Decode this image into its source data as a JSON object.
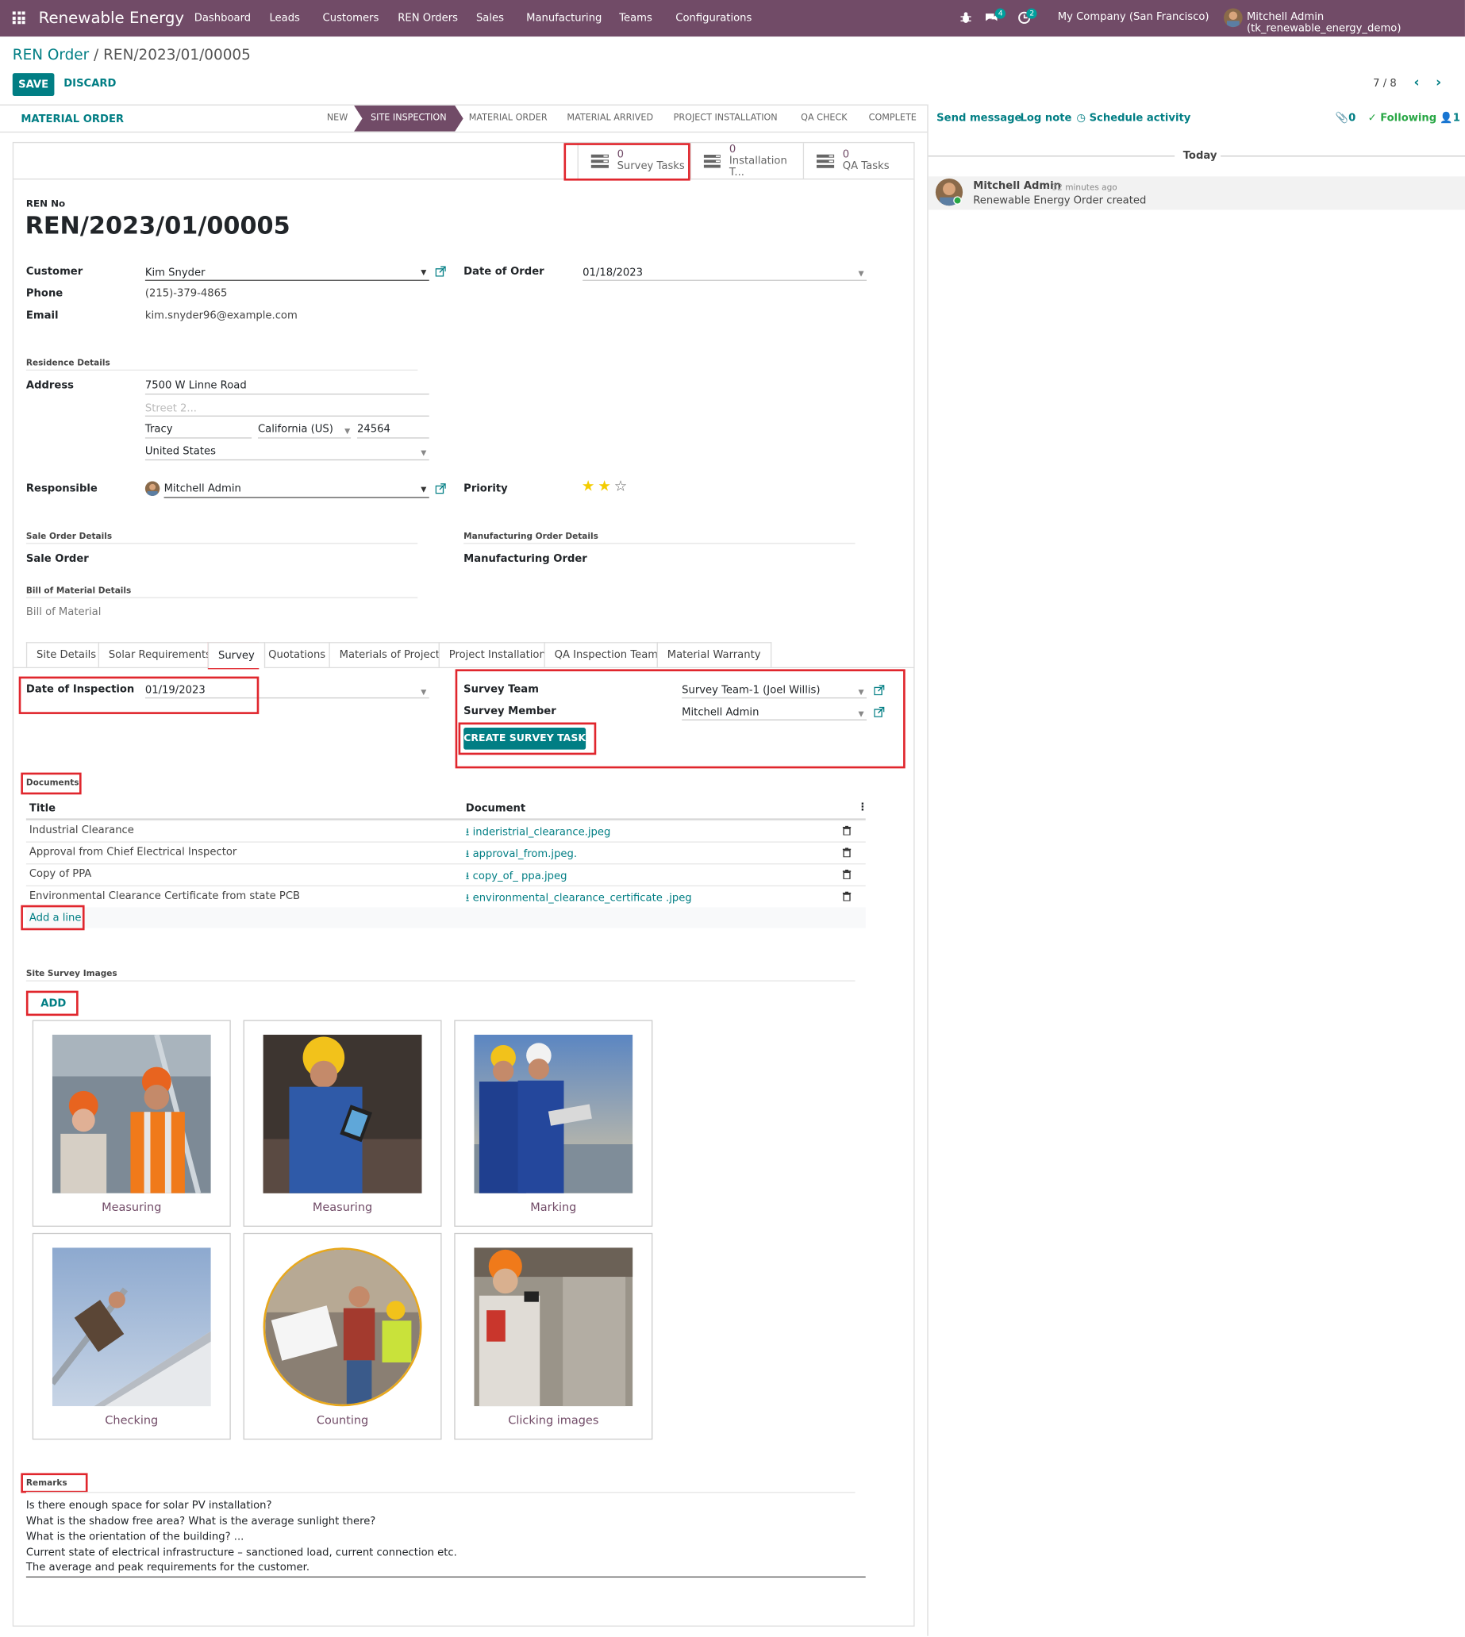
{
  "navbar": {
    "brand": "Renewable Energy",
    "menu": [
      "Dashboard",
      "Leads",
      "Customers",
      "REN Orders",
      "Sales",
      "Manufacturing",
      "Teams",
      "Configurations"
    ],
    "messages_badge": "4",
    "activities_badge": "2",
    "company": "My Company (San Francisco)",
    "user": "Mitchell Admin (tk_renewable_energy_demo)"
  },
  "breadcrumb": {
    "parent": "REN Order",
    "separator": " / ",
    "current": "REN/2023/01/00005"
  },
  "controls": {
    "save": "SAVE",
    "discard": "DISCARD",
    "pager": "7 / 8"
  },
  "statusbar": {
    "button": "MATERIAL ORDER",
    "stages": [
      "NEW",
      "SITE INSPECTION",
      "MATERIAL ORDER",
      "MATERIAL ARRIVED",
      "PROJECT INSTALLATION",
      "QA CHECK",
      "COMPLETE"
    ],
    "active_stage": "SITE INSPECTION"
  },
  "smart_buttons": [
    {
      "count": "0",
      "label": "Survey Tasks"
    },
    {
      "count": "0",
      "label": "Installation T..."
    },
    {
      "count": "0",
      "label": "QA Tasks"
    }
  ],
  "form": {
    "ren_no_label": "REN No",
    "ren_no": "REN/2023/01/00005",
    "customer_label": "Customer",
    "customer": "Kim Snyder",
    "phone_label": "Phone",
    "phone": "(215)-379-4865",
    "email_label": "Email",
    "email": "kim.snyder96@example.com",
    "date_order_label": "Date of Order",
    "date_order": "01/18/2023",
    "residence_title": "Residence Details",
    "address_label": "Address",
    "street": "7500 W Linne Road",
    "street2_placeholder": "Street 2...",
    "city": "Tracy",
    "state": "California (US)",
    "zip": "24564",
    "country": "United States",
    "responsible_label": "Responsible",
    "responsible": "Mitchell Admin",
    "priority_label": "Priority",
    "priority_stars": 2,
    "priority_max": 3,
    "sale_title": "Sale Order Details",
    "sale_label": "Sale Order",
    "mfg_title": "Manufacturing Order Details",
    "mfg_label": "Manufacturing Order",
    "bom_title": "Bill of Material Details",
    "bom_placeholder": "Bill of Material"
  },
  "tabs": [
    "Site Details",
    "Solar Requirements",
    "Survey",
    "Quotations",
    "Materials of Project",
    "Project Installation",
    "QA Inspection Team",
    "Material Warranty"
  ],
  "active_tab": "Survey",
  "survey": {
    "date_label": "Date of Inspection",
    "date": "01/19/2023",
    "team_label": "Survey Team",
    "team": "Survey Team-1 (Joel Willis)",
    "member_label": "Survey Member",
    "member": "Mitchell Admin",
    "create_button": "CREATE SURVEY TASK"
  },
  "documents": {
    "title": "Documents",
    "col_title": "Title",
    "col_document": "Document",
    "rows": [
      {
        "title": "Industrial Clearance",
        "file": "inderistrial_clearance.jpeg"
      },
      {
        "title": "Approval from Chief Electrical Inspector",
        "file": "approval_from.jpeg."
      },
      {
        "title": "Copy of PPA",
        "file": "copy_of_ ppa.jpeg"
      },
      {
        "title": "Environmental Clearance Certificate from state PCB",
        "file": "environmental_clearance_certificate .jpeg"
      }
    ],
    "add_line": "Add a line"
  },
  "images": {
    "title": "Site Survey Images",
    "add": "ADD",
    "captions": [
      "Measuring",
      "Measuring",
      "Marking",
      "Checking",
      "Counting",
      "Clicking images"
    ]
  },
  "remarks": {
    "title": "Remarks",
    "lines": [
      "Is there enough space for solar PV installation?",
      "What is the shadow free area? What is the average sunlight there?",
      "What is the orientation of the building? ...",
      "Current state of electrical infrastructure – sanctioned load, current connection etc.",
      "The average and peak requirements for the customer."
    ]
  },
  "chatter": {
    "send_message": "Send message",
    "log_note": "Log note",
    "schedule": "Schedule activity",
    "attachments": "0",
    "following": "Following",
    "followers": "1",
    "date_sep": "Today",
    "author": "Mitchell Admin",
    "time": "- 32 minutes ago",
    "body": "Renewable Energy Order created"
  },
  "colors": {
    "brand": "#714b67",
    "accent": "#017e84",
    "highlight": "#e0262d"
  }
}
